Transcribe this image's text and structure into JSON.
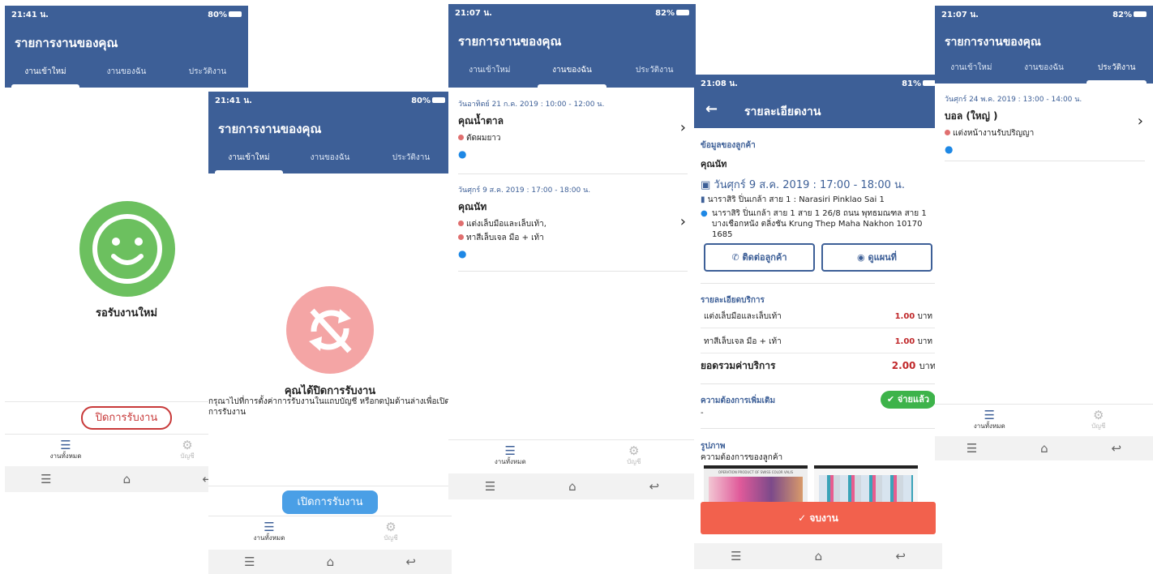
{
  "common": {
    "app_title": "รายการงานของคุณ",
    "tabs": [
      "งานเข้าใหม่",
      "งานของฉัน",
      "ประวัติงาน"
    ],
    "bottom": {
      "all": "งานทั้งหมด",
      "account": "บัญชี"
    },
    "nav_icons": [
      "menu-icon",
      "home-icon",
      "back-icon"
    ]
  },
  "s1": {
    "time": "21:41 น.",
    "battery": "80%",
    "waiting": "รอรับงานใหม่",
    "close_btn": "ปิดการรับงาน"
  },
  "s2": {
    "time": "21:41 น.",
    "battery": "80%",
    "title": "คุณได้ปิดการรับงาน",
    "desc": "กรุณาไปที่การตั้งค่าการรับงานในแถบบัญชี หรือกดปุ่มด้านล่างเพื่อเปิดการรับงาน",
    "open_btn": "เปิดการรับงาน"
  },
  "s3": {
    "time": "21:07 น.",
    "battery": "82%",
    "jobs": [
      {
        "date": "วันอาทิตย์ 21 ก.ค. 2019 : 10:00 - 12:00 น.",
        "name": "คุณน้ำตาล",
        "services": [
          "ตัดผมยาว"
        ]
      },
      {
        "date": "วันศุกร์ 9 ส.ค. 2019 : 17:00 - 18:00 น.",
        "name": "คุณนัท",
        "services": [
          "แต่งเล็บมือและเล็บเท้า,",
          "ทาสีเล็บเจล มือ + เท้า"
        ]
      }
    ]
  },
  "s4": {
    "time": "21:08 น.",
    "battery": "81%",
    "title": "รายละเอียดงาน",
    "customer_section": "ข้อมูลของลูกค้า",
    "customer": "คุณนัท",
    "datetime": "วันศุกร์ 9 ส.ค. 2019 : 17:00 - 18:00 น.",
    "building": "นาราสิริ ปิ่นเกล้า สาย 1 : Narasiri Pinklao Sai 1",
    "address": "นาราสิริ ปิ่นเกล้า สาย 1 สาย 1 26/8 ถนน พุทธมณฑล สาย 1 บางเชือกหนัง ตลิ่งชัน Krung Thep Maha Nakhon 10170 1685",
    "contact_btn": "ติดต่อลูกค้า",
    "map_btn": "ดูแผนที่",
    "service_section": "รายละเอียดบริการ",
    "services": [
      {
        "name": "แต่งเล็บมือและเล็บเท้า",
        "price": "1.00",
        "unit": "บาท"
      },
      {
        "name": "ทาสีเล็บเจล มือ + เท้า",
        "price": "1.00",
        "unit": "บาท"
      }
    ],
    "total_label": "ยอดรวมค่าบริการ",
    "total": "2.00",
    "total_unit": "บาท",
    "extra_label": "ความต้องการเพิ่มเติม",
    "extra_value": "-",
    "paid": "จ่ายแล้ว",
    "photo_label": "รูปภาพ",
    "photo_sub": "ความต้องการของลูกค้า",
    "photo_caption": "OPERATION PRODUCT OF SWISS COLOR VALIS",
    "finish_btn": "จบงาน"
  },
  "s5": {
    "time": "21:07 น.",
    "battery": "82%",
    "job": {
      "date": "วันศุกร์ 24 พ.ค. 2019 : 13:00 - 14:00 น.",
      "name": "บอล (ใหญ่ )",
      "services": [
        "แต่งหน้างานรับปริญญา"
      ]
    }
  }
}
